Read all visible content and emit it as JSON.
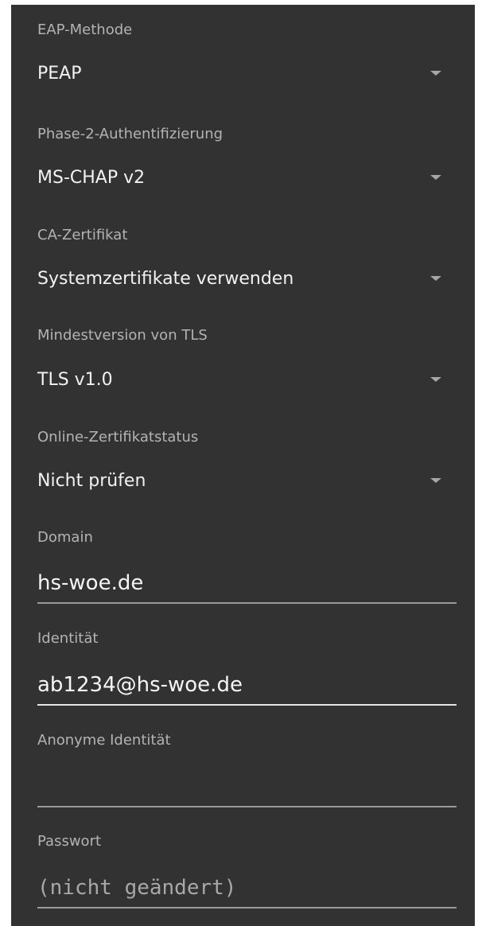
{
  "eap_method": {
    "label": "EAP-Methode",
    "value": "PEAP"
  },
  "phase2_auth": {
    "label": "Phase-2-Authentifizierung",
    "value": "MS-CHAP v2"
  },
  "ca_certificate": {
    "label": "CA-Zertifikat",
    "value": "Systemzertifikate verwenden"
  },
  "tls_min_version": {
    "label": "Mindestversion von TLS",
    "value": "TLS v1.0"
  },
  "online_cert_status": {
    "label": "Online-Zertifikatstatus",
    "value": "Nicht prüfen"
  },
  "domain": {
    "label": "Domain",
    "value": "hs-woe.de"
  },
  "identity": {
    "label": "Identität",
    "value": "ab1234@hs-woe.de"
  },
  "anonymous_identity": {
    "label": "Anonyme Identität",
    "value": ""
  },
  "password": {
    "label": "Passwort",
    "placeholder": "(nicht geändert)"
  },
  "icons": {
    "dropdown": "chevron-down-icon"
  },
  "colors": {
    "background": "#323232",
    "label_text": "#b3b3b3",
    "value_text": "#f2f2f2",
    "underline": "#9a9a9a",
    "underline_focused": "#e6e6e6"
  }
}
